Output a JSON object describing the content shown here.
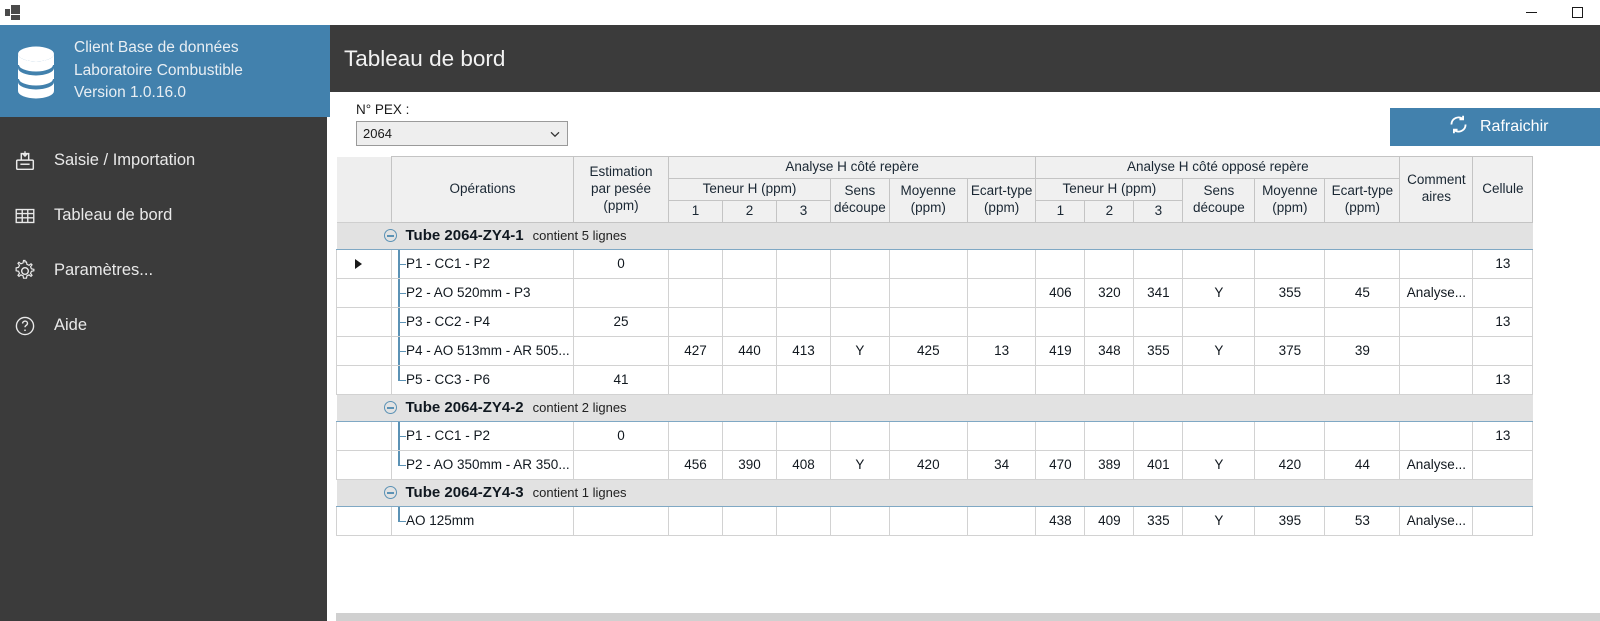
{
  "window": {
    "icon": "app-windows-icon",
    "minimize_label": "—",
    "maximize_label": "□"
  },
  "sidebar": {
    "brand": {
      "icon": "database-icon",
      "line1": "Client Base de données",
      "line2": "Laboratoire Combustible",
      "line3": "Version 1.0.16.0",
      "bg_color": "#4281ad"
    },
    "bg_color": "#3b3b3b",
    "items": [
      {
        "icon": "import-data-icon",
        "label": "Saisie / Importation"
      },
      {
        "icon": "grid-table-icon",
        "label": "Tableau de bord"
      },
      {
        "icon": "gear-icon",
        "label": "Paramètres..."
      },
      {
        "icon": "help-circle-icon",
        "label": "Aide"
      }
    ]
  },
  "header": {
    "title": "Tableau de bord"
  },
  "toolbar": {
    "pex_label": "N° PEX :",
    "pex_value": "2064",
    "pex_options": [
      "2064"
    ],
    "refresh_label": "Rafraichir",
    "refresh_icon": "refresh-icon",
    "refresh_color": "#4281ad"
  },
  "grid": {
    "group_headers": [
      {
        "label": "",
        "colspan": 1,
        "kind": "rowsel"
      },
      {
        "label": "Opérations",
        "rowspan": 3
      },
      {
        "label": "Estimation\npar pesée\n(ppm)",
        "rowspan": 3
      },
      {
        "label": "Analyse H côté repère",
        "colspan": 6
      },
      {
        "label": "Analyse H côté opposé repère",
        "colspan": 6
      },
      {
        "label": "Comment\naires",
        "rowspan": 3
      },
      {
        "label": "Cellule",
        "rowspan": 3
      }
    ],
    "sub_headers": {
      "teneur": "Teneur H (ppm)",
      "sens": "Sens\ndécoupe",
      "moyenne": "Moyenne\n(ppm)",
      "ecart": "Ecart-type\n(ppm)",
      "teneur_cols": [
        "1",
        "2",
        "3"
      ]
    },
    "column_labels": [
      "Opérations",
      "Estimation par pesée (ppm)",
      "Teneur H (ppm) 1",
      "Teneur H (ppm) 2",
      "Teneur H (ppm) 3",
      "Sens découpe",
      "Moyenne (ppm)",
      "Ecart-type (ppm)",
      "Teneur H (ppm) 1",
      "Teneur H (ppm) 2",
      "Teneur H (ppm) 3",
      "Sens découpe",
      "Moyenne (ppm)",
      "Ecart-type (ppm)",
      "Commentaires",
      "Cellule"
    ],
    "groups": [
      {
        "title": "Tube 2064-ZY4-1",
        "subtitle": "contient 5 lignes",
        "expanded": true,
        "rows": [
          {
            "selected": true,
            "operation": "P1 - CC1 - P2",
            "estimation": "0",
            "left": {
              "t1": "",
              "t2": "",
              "t3": "",
              "sens": "",
              "moyenne": "",
              "ecart": ""
            },
            "right": {
              "t1": "",
              "t2": "",
              "t3": "",
              "sens": "",
              "moyenne": "",
              "ecart": ""
            },
            "commentaires": "",
            "cellule": "13"
          },
          {
            "selected": false,
            "operation": "P2 - AO 520mm - P3",
            "estimation": "",
            "left": {
              "t1": "",
              "t2": "",
              "t3": "",
              "sens": "",
              "moyenne": "",
              "ecart": ""
            },
            "right": {
              "t1": "406",
              "t2": "320",
              "t3": "341",
              "sens": "Y",
              "moyenne": "355",
              "ecart": "45"
            },
            "commentaires": "Analyse...",
            "cellule": ""
          },
          {
            "selected": false,
            "operation": "P3 - CC2 - P4",
            "estimation": "25",
            "left": {
              "t1": "",
              "t2": "",
              "t3": "",
              "sens": "",
              "moyenne": "",
              "ecart": ""
            },
            "right": {
              "t1": "",
              "t2": "",
              "t3": "",
              "sens": "",
              "moyenne": "",
              "ecart": ""
            },
            "commentaires": "",
            "cellule": "13"
          },
          {
            "selected": false,
            "operation": "P4 - AO 513mm - AR 505...",
            "estimation": "",
            "left": {
              "t1": "427",
              "t2": "440",
              "t3": "413",
              "sens": "Y",
              "moyenne": "425",
              "ecart": "13"
            },
            "right": {
              "t1": "419",
              "t2": "348",
              "t3": "355",
              "sens": "Y",
              "moyenne": "375",
              "ecart": "39"
            },
            "commentaires": "",
            "cellule": ""
          },
          {
            "selected": false,
            "operation": "P5 - CC3 - P6",
            "estimation": "41",
            "left": {
              "t1": "",
              "t2": "",
              "t3": "",
              "sens": "",
              "moyenne": "",
              "ecart": ""
            },
            "right": {
              "t1": "",
              "t2": "",
              "t3": "",
              "sens": "",
              "moyenne": "",
              "ecart": ""
            },
            "commentaires": "",
            "cellule": "13"
          }
        ]
      },
      {
        "title": "Tube 2064-ZY4-2",
        "subtitle": "contient 2 lignes",
        "expanded": true,
        "rows": [
          {
            "selected": false,
            "operation": "P1 - CC1 - P2",
            "estimation": "0",
            "left": {
              "t1": "",
              "t2": "",
              "t3": "",
              "sens": "",
              "moyenne": "",
              "ecart": ""
            },
            "right": {
              "t1": "",
              "t2": "",
              "t3": "",
              "sens": "",
              "moyenne": "",
              "ecart": ""
            },
            "commentaires": "",
            "cellule": "13"
          },
          {
            "selected": false,
            "operation": "P2 - AO 350mm - AR 350...",
            "estimation": "",
            "left": {
              "t1": "456",
              "t2": "390",
              "t3": "408",
              "sens": "Y",
              "moyenne": "420",
              "ecart": "34"
            },
            "right": {
              "t1": "470",
              "t2": "389",
              "t3": "401",
              "sens": "Y",
              "moyenne": "420",
              "ecart": "44"
            },
            "commentaires": "Analyse...",
            "cellule": ""
          }
        ]
      },
      {
        "title": "Tube 2064-ZY4-3",
        "subtitle": "contient 1 lignes",
        "expanded": true,
        "rows": [
          {
            "selected": false,
            "operation": "AO 125mm",
            "estimation": "",
            "left": {
              "t1": "",
              "t2": "",
              "t3": "",
              "sens": "",
              "moyenne": "",
              "ecart": ""
            },
            "right": {
              "t1": "438",
              "t2": "409",
              "t3": "335",
              "sens": "Y",
              "moyenne": "395",
              "ecart": "53"
            },
            "commentaires": "Analyse...",
            "cellule": ""
          }
        ]
      }
    ]
  }
}
